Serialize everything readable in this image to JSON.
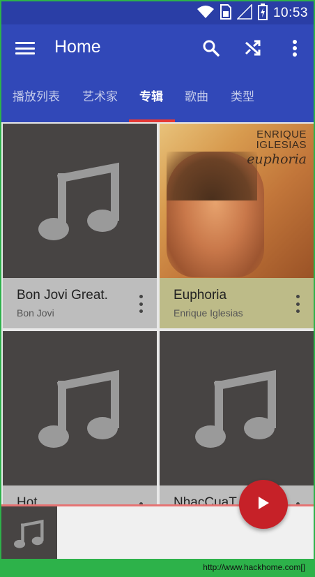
{
  "status_bar": {
    "time": "10:53",
    "icons": [
      "wifi-icon",
      "sim-card-icon",
      "signal-icon",
      "battery-charging-icon"
    ]
  },
  "app_bar": {
    "title": "Home",
    "menu_icon": "hamburger-menu-icon",
    "actions": [
      "search-icon",
      "shuffle-icon",
      "more-vert-icon"
    ]
  },
  "tabs": [
    {
      "label": "播放列表",
      "active": false
    },
    {
      "label": "艺术家",
      "active": false
    },
    {
      "label": "专辑",
      "active": true
    },
    {
      "label": "歌曲",
      "active": false
    },
    {
      "label": "类型",
      "active": false
    }
  ],
  "albums": [
    {
      "title": "Bon Jovi Great.",
      "artist": "Bon Jovi",
      "art": "music-note-icon"
    },
    {
      "title": "Euphoria",
      "artist": "Enrique Iglesias",
      "art": "album-cover",
      "cover_text": {
        "line1": "ENRIQUE",
        "line2": "IGLESIAS",
        "line3": "euphoria"
      }
    },
    {
      "title": "Hot",
      "artist": "",
      "art": "music-note-icon"
    },
    {
      "title": "NhacCuaT",
      "artist": "",
      "art": "music-note-icon"
    }
  ],
  "mini_player": {
    "art": "music-note-icon",
    "play_icon": "play-icon"
  },
  "watermark": "http://www.hackhome.com[]"
}
